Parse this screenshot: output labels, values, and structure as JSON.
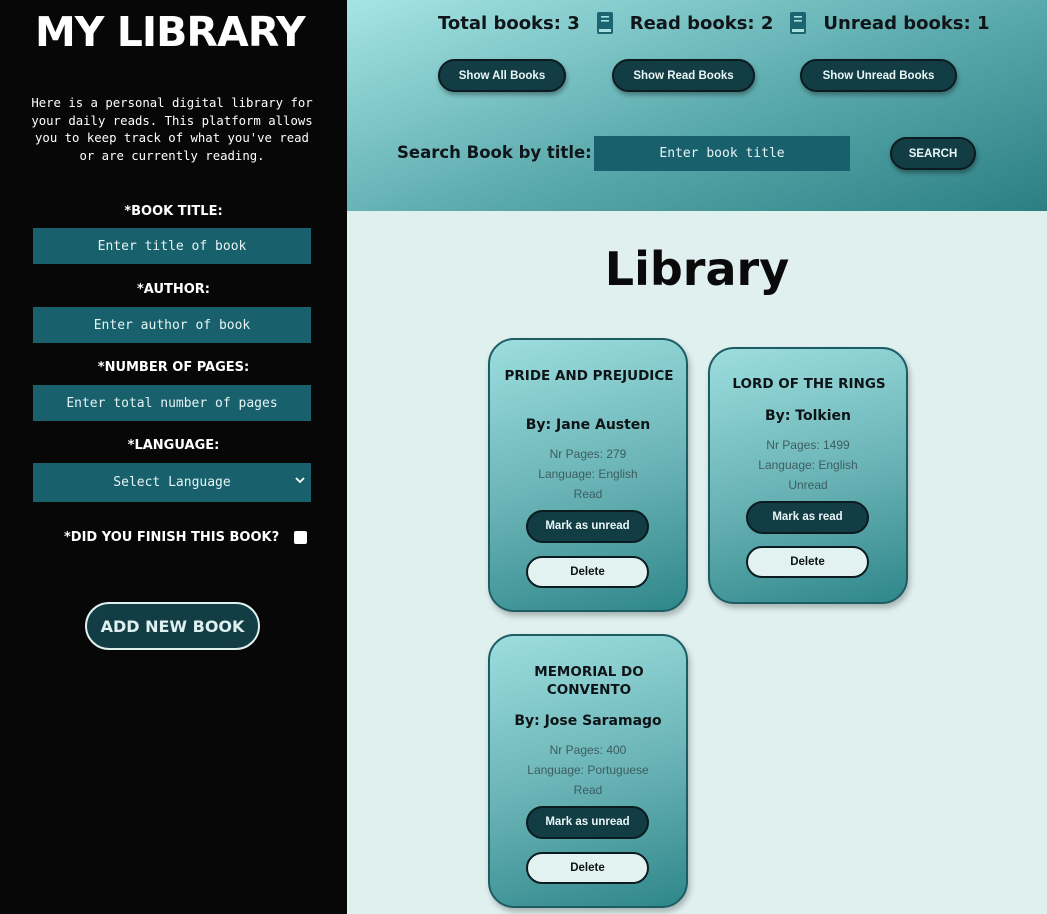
{
  "sidebar": {
    "title": "MY LIBRARY",
    "intro": "Here is a personal digital library for your daily reads. This platform allows you to keep track of what you've read or are currently reading.",
    "form": {
      "title_label": "*BOOK TITLE:",
      "title_placeholder": "Enter title of book",
      "author_label": "*AUTHOR:",
      "author_placeholder": "Enter author of book",
      "pages_label": "*NUMBER OF PAGES:",
      "pages_placeholder": "Enter total number of pages",
      "language_label": "*LANGUAGE:",
      "language_selected": "Select Language",
      "finished_label": "*DID YOU FINISH THIS BOOK?",
      "finished_checked": false,
      "add_button": "ADD NEW BOOK"
    }
  },
  "header": {
    "stats": {
      "total": "Total books: 3",
      "read": "Read books: 2",
      "unread": "Unread books: 1",
      "icon": "book-icon"
    },
    "filters": {
      "all": "Show All Books",
      "read": "Show Read Books",
      "unread": "Show Unread Books"
    },
    "search": {
      "label": "Search Book by title:",
      "placeholder": "Enter book title",
      "button": "SEARCH"
    }
  },
  "main": {
    "title": "Library",
    "books": [
      {
        "title": "PRIDE AND PREJUDICE",
        "author": "By: Jane Austen",
        "pages": "Nr Pages: 279",
        "language": "Language: English",
        "status": "Read",
        "toggle_label": "Mark as unread",
        "delete_label": "Delete"
      },
      {
        "title": "LORD OF THE RINGS",
        "author": "By: Tolkien",
        "pages": "Nr Pages: 1499",
        "language": "Language: English",
        "status": "Unread",
        "toggle_label": "Mark as read",
        "delete_label": "Delete"
      },
      {
        "title": "MEMORIAL DO CONVENTO",
        "author": "By: Jose Saramago",
        "pages": "Nr Pages: 400",
        "language": "Language: Portuguese",
        "status": "Read",
        "toggle_label": "Mark as unread",
        "delete_label": "Delete"
      }
    ]
  },
  "colors": {
    "sidebar_bg": "#070707",
    "input_bg": "#17606c",
    "button_dark": "#133d45",
    "page_bg": "#dff0ef",
    "card_top": "#9ddedf",
    "card_bottom": "#2f878a"
  }
}
